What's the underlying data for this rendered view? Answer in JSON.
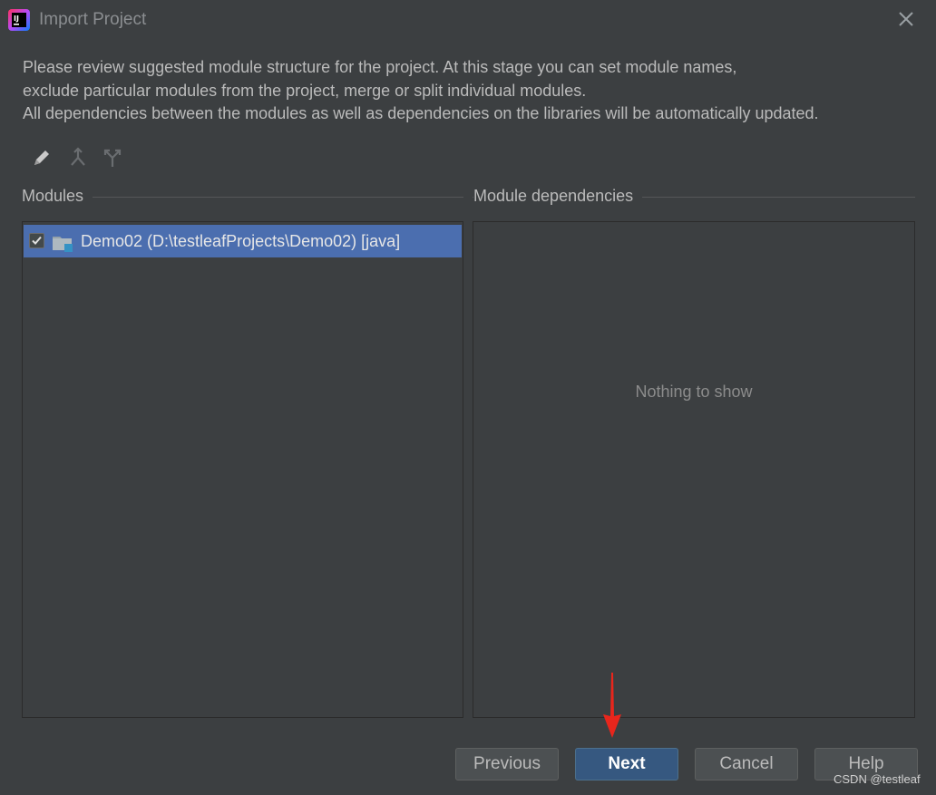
{
  "window": {
    "title": "Import Project",
    "app_icon": "intellij-idea-icon",
    "close_icon": "close-icon"
  },
  "description": {
    "lines": [
      "Please review suggested module structure for the project. At this stage you can set module names,",
      "exclude particular modules from the project, merge or split individual modules.",
      "All dependencies between the modules as well as dependencies on the libraries will be automatically updated."
    ]
  },
  "toolbar": {
    "items": [
      {
        "icon": "edit-pencil-icon",
        "enabled": true
      },
      {
        "icon": "merge-icon",
        "enabled": false
      },
      {
        "icon": "split-icon",
        "enabled": false
      }
    ]
  },
  "modules": {
    "header": "Modules",
    "items": [
      {
        "label": "Demo02 (D:\\testleafProjects\\Demo02) [java]",
        "checked": true,
        "selected": true,
        "icon": "module-folder-icon"
      }
    ]
  },
  "dependencies": {
    "header": "Module dependencies",
    "empty_text": "Nothing to show"
  },
  "buttons": {
    "previous": "Previous",
    "next": "Next",
    "cancel": "Cancel",
    "help": "Help"
  },
  "annotation": {
    "arrow_color": "#e8261c",
    "target": "next-button"
  },
  "watermark": "CSDN @testleaf",
  "colors": {
    "background": "#3c3f41",
    "selection": "#4b6eaf",
    "default_button": "#365880"
  }
}
